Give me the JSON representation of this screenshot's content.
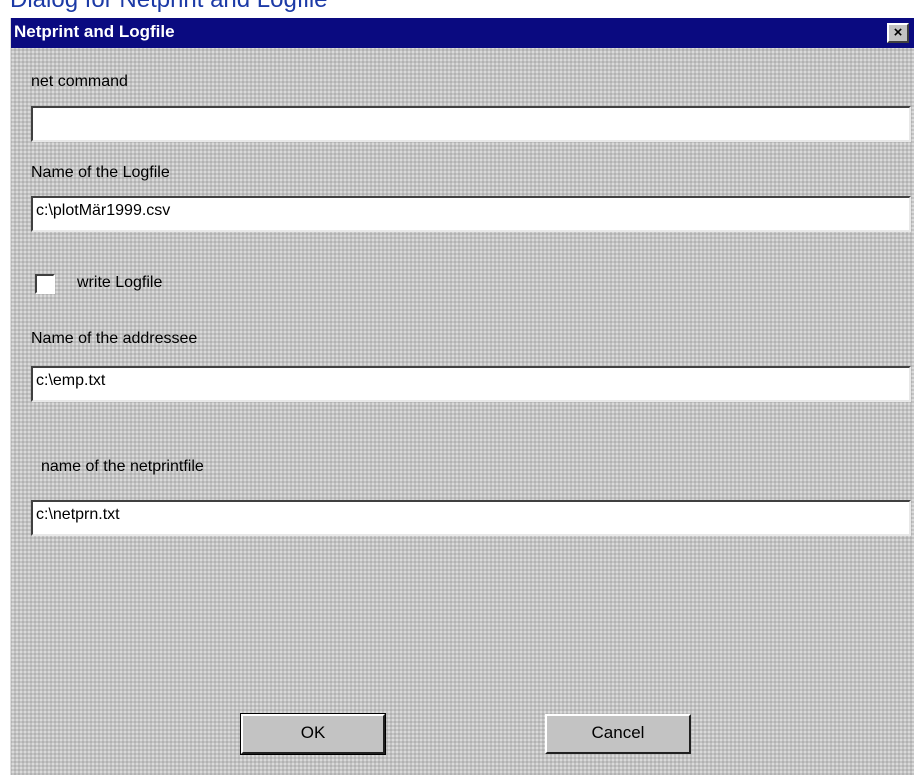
{
  "page_heading": "Dialog for Netprint and Logfile",
  "dialog": {
    "title": "Netprint and Logfile",
    "close_symbol": "×"
  },
  "fields": {
    "net_command": {
      "label": "net command",
      "value": ""
    },
    "logfile_name": {
      "label": "Name of the Logfile",
      "value": "c:\\plotMär1999.csv"
    },
    "write_logfile": {
      "label": "write Logfile",
      "checked": false
    },
    "addressee_name": {
      "label": "Name of the addressee",
      "value": "c:\\emp.txt"
    },
    "netprintfile_name": {
      "label": "name of the netprintfile",
      "value": "c:\\netprn.txt"
    }
  },
  "buttons": {
    "ok": "OK",
    "cancel": "Cancel"
  },
  "icons": {
    "close": "close-icon"
  },
  "colors": {
    "titlebar": "#0a0a80",
    "dialog_bg": "#c3c3c3",
    "heading": "#1c3aa6"
  }
}
